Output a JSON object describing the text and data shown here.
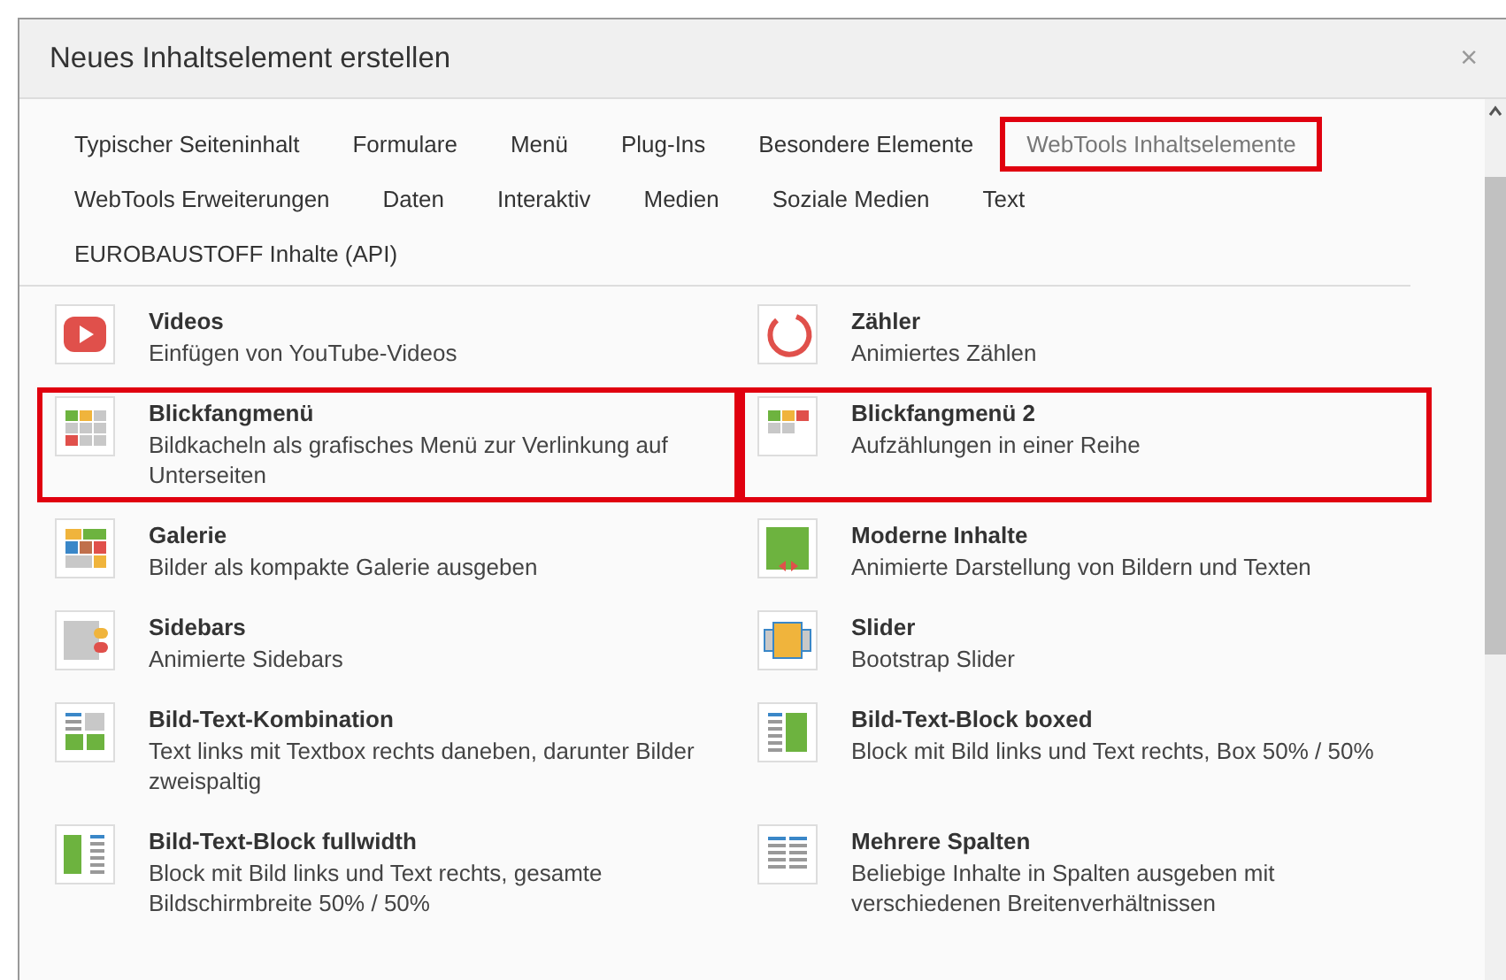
{
  "dialog": {
    "title": "Neues Inhaltselement erstellen",
    "close": "×"
  },
  "tabs": [
    {
      "label": "Typischer Seiteninhalt",
      "selected": false
    },
    {
      "label": "Formulare",
      "selected": false
    },
    {
      "label": "Menü",
      "selected": false
    },
    {
      "label": "Plug-Ins",
      "selected": false
    },
    {
      "label": "Besondere Elemente",
      "selected": false
    },
    {
      "label": "WebTools Inhaltselemente",
      "selected": true
    },
    {
      "label": "WebTools Erweiterungen",
      "selected": false
    },
    {
      "label": "Daten",
      "selected": false
    },
    {
      "label": "Interaktiv",
      "selected": false
    },
    {
      "label": "Medien",
      "selected": false
    },
    {
      "label": "Soziale Medien",
      "selected": false
    },
    {
      "label": "Text",
      "selected": false
    },
    {
      "label": "EUROBAUSTOFF Inhalte (API)",
      "selected": false
    }
  ],
  "elements": [
    {
      "kind": "video",
      "title": "Videos",
      "description": "Einfügen von YouTube-Videos",
      "highlighted": false
    },
    {
      "kind": "counter",
      "title": "Zähler",
      "description": "Animiertes Zählen",
      "highlighted": false
    },
    {
      "kind": "tiles",
      "title": "Blickfangmenü",
      "description": "Bildkacheln als grafisches Menü zur Verlinkung auf Unterseiten",
      "highlighted": true
    },
    {
      "kind": "tiles-row",
      "title": "Blickfangmenü 2",
      "description": "Aufzählungen in einer Reihe",
      "highlighted": true
    },
    {
      "kind": "gallery",
      "title": "Galerie",
      "description": "Bilder als kompakte Galerie ausgeben",
      "highlighted": false
    },
    {
      "kind": "modern",
      "title": "Moderne Inhalte",
      "description": "Animierte Darstellung von Bildern und Texten",
      "highlighted": false
    },
    {
      "kind": "sidebars",
      "title": "Sidebars",
      "description": "Animierte Sidebars",
      "highlighted": false
    },
    {
      "kind": "slider",
      "title": "Slider",
      "description": "Bootstrap Slider",
      "highlighted": false
    },
    {
      "kind": "text-image-grid",
      "title": "Bild-Text-Kombination",
      "description": "Text links mit Textbox rechts daneben, darunter Bilder zweispaltig",
      "highlighted": false
    },
    {
      "kind": "text-image-boxed",
      "title": "Bild-Text-Block boxed",
      "description": "Block mit Bild links und Text rechts, Box 50% / 50%",
      "highlighted": false
    },
    {
      "kind": "image-text-full",
      "title": "Bild-Text-Block fullwidth",
      "description": "Block mit Bild links und Text rechts, gesamte Bildschirmbreite 50% / 50%",
      "highlighted": false
    },
    {
      "kind": "columns",
      "title": "Mehrere Spalten",
      "description": "Beliebige Inhalte in Spalten ausgeben mit verschiedenen Breitenverhältnissen",
      "highlighted": false
    }
  ]
}
